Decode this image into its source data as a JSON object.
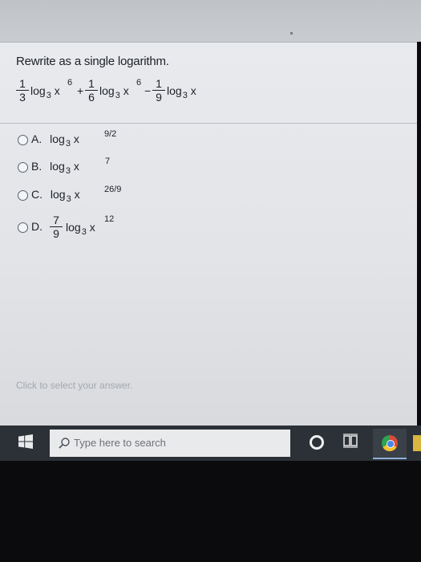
{
  "question": {
    "prompt": "Rewrite as a single logarithm."
  },
  "expression": {
    "term1": {
      "num": "1",
      "den": "3",
      "log": "log",
      "base": "3",
      "var": "x",
      "exp": "6"
    },
    "op1": "+",
    "term2": {
      "num": "1",
      "den": "6",
      "log": "log",
      "base": "3",
      "var": "x",
      "exp": "6"
    },
    "op2": "−",
    "term3": {
      "num": "1",
      "den": "9",
      "log": "log",
      "base": "3",
      "var": "x"
    }
  },
  "options": [
    {
      "letter": "A.",
      "log": "log",
      "base": "3",
      "var": "x",
      "exp": "9/2"
    },
    {
      "letter": "B.",
      "log": "log",
      "base": "3",
      "var": "x",
      "exp": "7"
    },
    {
      "letter": "C.",
      "log": "log",
      "base": "3",
      "var": "x",
      "exp": "26/9"
    },
    {
      "letter": "D.",
      "num": "7",
      "den": "9",
      "log": "log",
      "base": "3",
      "var": "x",
      "exp": "12"
    }
  ],
  "hint": "Click to select your answer.",
  "taskbar": {
    "search_placeholder": "Type here to search",
    "icons": [
      "windows-icon",
      "search-icon",
      "cortana-icon",
      "task-view-icon",
      "chrome-icon"
    ]
  },
  "colors": {
    "panel": "#e4e6ea",
    "text": "#1d2026",
    "taskbar": "#2b3137",
    "hint": "#a4a8ae"
  }
}
